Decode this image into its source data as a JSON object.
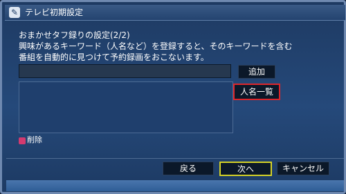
{
  "window": {
    "title": "テレビ初期設定",
    "icon": "wrench-icon"
  },
  "description": {
    "line1": "おまかせタフ録りの設定(2/2)",
    "line2": "興味があるキーワード（人名など）を登録すると、そのキーワードを含む",
    "line3": "番組を自動的に見つけて予約録画をおこないます。"
  },
  "keyword": {
    "value": ""
  },
  "buttons": {
    "add": "追加",
    "name_list": "人名一覧",
    "back": "戻る",
    "next": "次へ",
    "cancel": "キャンセル"
  },
  "delete": {
    "label": "削除",
    "color": "#d33a6f"
  },
  "colors": {
    "highlight": "#e0262a",
    "focus": "#d7d325"
  }
}
